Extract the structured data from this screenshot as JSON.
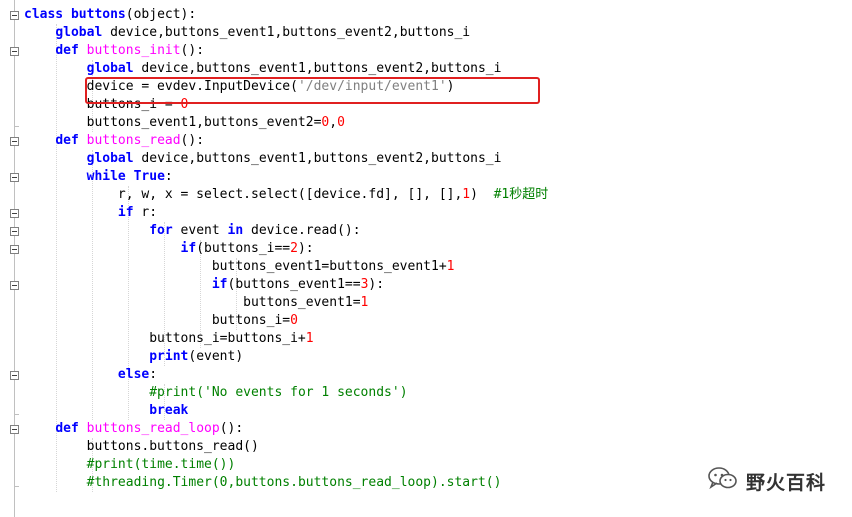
{
  "editor": {
    "lines": [
      [
        {
          "t": "class ",
          "c": "kw"
        },
        {
          "t": "buttons",
          "c": "kw"
        },
        {
          "t": "(object):",
          "c": "plain"
        }
      ],
      [
        {
          "t": "    ",
          "c": "plain"
        },
        {
          "t": "global ",
          "c": "kw"
        },
        {
          "t": "device,buttons_event1,buttons_event2,buttons_i",
          "c": "plain"
        }
      ],
      [
        {
          "t": "    ",
          "c": "plain"
        },
        {
          "t": "def ",
          "c": "kw"
        },
        {
          "t": "buttons_init",
          "c": "fn"
        },
        {
          "t": "():",
          "c": "plain"
        }
      ],
      [
        {
          "t": "        ",
          "c": "plain"
        },
        {
          "t": "global ",
          "c": "kw"
        },
        {
          "t": "device,buttons_event1,buttons_event2,buttons_i",
          "c": "plain"
        }
      ],
      [
        {
          "t": "        device = evdev.InputDevice(",
          "c": "plain"
        },
        {
          "t": "'/dev/input/event1'",
          "c": "str"
        },
        {
          "t": ")",
          "c": "plain"
        }
      ],
      [
        {
          "t": "        buttons_i = ",
          "c": "plain"
        },
        {
          "t": "0",
          "c": "num"
        }
      ],
      [
        {
          "t": "        buttons_event1,buttons_event2=",
          "c": "plain"
        },
        {
          "t": "0",
          "c": "num"
        },
        {
          "t": ",",
          "c": "plain"
        },
        {
          "t": "0",
          "c": "num"
        }
      ],
      [
        {
          "t": "    ",
          "c": "plain"
        },
        {
          "t": "def ",
          "c": "kw"
        },
        {
          "t": "buttons_read",
          "c": "fn"
        },
        {
          "t": "():",
          "c": "plain"
        }
      ],
      [
        {
          "t": "        ",
          "c": "plain"
        },
        {
          "t": "global ",
          "c": "kw"
        },
        {
          "t": "device,buttons_event1,buttons_event2,buttons_i",
          "c": "plain"
        }
      ],
      [
        {
          "t": "        ",
          "c": "plain"
        },
        {
          "t": "while ",
          "c": "kw"
        },
        {
          "t": "True",
          "c": "kw"
        },
        {
          "t": ":",
          "c": "plain"
        }
      ],
      [
        {
          "t": "            r, w, x = select.select([device.fd], [], [],",
          "c": "plain"
        },
        {
          "t": "1",
          "c": "num"
        },
        {
          "t": ")  ",
          "c": "plain"
        },
        {
          "t": "#1秒超时",
          "c": "com"
        }
      ],
      [
        {
          "t": "            ",
          "c": "plain"
        },
        {
          "t": "if ",
          "c": "kw"
        },
        {
          "t": "r:",
          "c": "plain"
        }
      ],
      [
        {
          "t": "                ",
          "c": "plain"
        },
        {
          "t": "for ",
          "c": "kw"
        },
        {
          "t": "event ",
          "c": "plain"
        },
        {
          "t": "in ",
          "c": "kw"
        },
        {
          "t": "device.read():",
          "c": "plain"
        }
      ],
      [
        {
          "t": "                    ",
          "c": "plain"
        },
        {
          "t": "if",
          "c": "kw"
        },
        {
          "t": "(buttons_i==",
          "c": "plain"
        },
        {
          "t": "2",
          "c": "num"
        },
        {
          "t": "):",
          "c": "plain"
        }
      ],
      [
        {
          "t": "                        buttons_event1=buttons_event1+",
          "c": "plain"
        },
        {
          "t": "1",
          "c": "num"
        }
      ],
      [
        {
          "t": "                        ",
          "c": "plain"
        },
        {
          "t": "if",
          "c": "kw"
        },
        {
          "t": "(buttons_event1==",
          "c": "plain"
        },
        {
          "t": "3",
          "c": "num"
        },
        {
          "t": "):",
          "c": "plain"
        }
      ],
      [
        {
          "t": "                            buttons_event1=",
          "c": "plain"
        },
        {
          "t": "1",
          "c": "num"
        }
      ],
      [
        {
          "t": "                        buttons_i=",
          "c": "plain"
        },
        {
          "t": "0",
          "c": "num"
        }
      ],
      [
        {
          "t": "                buttons_i=buttons_i+",
          "c": "plain"
        },
        {
          "t": "1",
          "c": "num"
        }
      ],
      [
        {
          "t": "                ",
          "c": "plain"
        },
        {
          "t": "print",
          "c": "kw"
        },
        {
          "t": "(event)",
          "c": "plain"
        }
      ],
      [
        {
          "t": "            ",
          "c": "plain"
        },
        {
          "t": "else",
          "c": "kw"
        },
        {
          "t": ":",
          "c": "plain"
        }
      ],
      [
        {
          "t": "                ",
          "c": "plain"
        },
        {
          "t": "#print('No events for 1 seconds')",
          "c": "com"
        }
      ],
      [
        {
          "t": "                ",
          "c": "plain"
        },
        {
          "t": "break",
          "c": "kw"
        }
      ],
      [
        {
          "t": "    ",
          "c": "plain"
        },
        {
          "t": "def ",
          "c": "kw"
        },
        {
          "t": "buttons_read_loop",
          "c": "fn"
        },
        {
          "t": "():",
          "c": "plain"
        }
      ],
      [
        {
          "t": "        buttons.buttons_read()",
          "c": "plain"
        }
      ],
      [
        {
          "t": "        ",
          "c": "plain"
        },
        {
          "t": "#print(time.time())",
          "c": "com"
        }
      ],
      [
        {
          "t": "        ",
          "c": "plain"
        },
        {
          "t": "#threading.Timer(0,buttons.buttons_read_loop).start()",
          "c": "com"
        }
      ]
    ],
    "fold_markers": [
      0,
      2,
      7,
      9,
      11,
      12,
      13,
      15,
      20,
      23
    ]
  },
  "watermark": {
    "text": "野火百科",
    "icon": "wechat-icon"
  },
  "colors": {
    "keyword": "#0000ff",
    "function_name": "#ff00ff",
    "number": "#ff0000",
    "string": "#808080",
    "comment": "#008000",
    "highlight_box": "#e02020"
  }
}
